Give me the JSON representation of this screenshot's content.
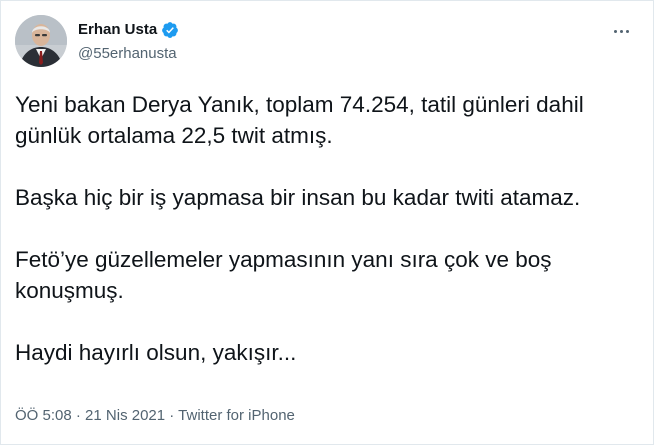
{
  "author": {
    "display_name": "Erhan Usta",
    "handle": "@55erhanusta",
    "verified": true
  },
  "tweet": {
    "paragraphs": [
      "Yeni bakan Derya Yanık, toplam 74.254, tatil günleri dahil günlük ortalama 22,5 twit atmış.",
      "Başka hiç bir iş yapmasa bir insan bu kadar twiti atamaz.",
      "Fetö’ye güzellemeler yapmasının yanı sıra çok ve boş konuşmuş.",
      "Haydi hayırlı olsun, yakışır..."
    ]
  },
  "meta": {
    "time": "ÖÖ 5:08",
    "separator": " · ",
    "date": "21 Nis 2021",
    "source": "Twitter for iPhone"
  },
  "colors": {
    "verified_blue": "#1d9bf0",
    "secondary_text": "#536471",
    "primary_text": "#0f1419",
    "border": "#e1e8ed"
  },
  "icons": {
    "verified": "verified-badge-icon",
    "more": "more-options-icon"
  }
}
